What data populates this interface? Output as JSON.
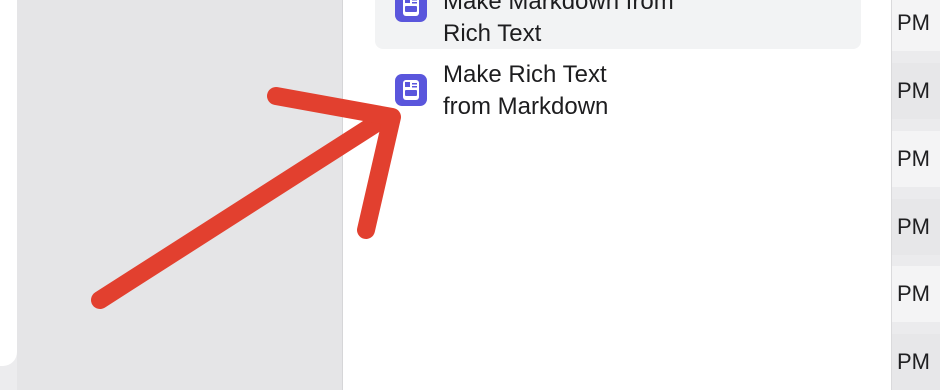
{
  "actions": [
    {
      "icon": "rich-text-icon",
      "line1": "Make Markdown from",
      "line2": "Rich Text"
    },
    {
      "icon": "rich-text-icon",
      "line1": "Make Rich Text",
      "line2": "from Markdown"
    }
  ],
  "time_column": [
    "PM",
    "PM",
    "PM",
    "PM",
    "PM",
    "PM"
  ],
  "annotation": {
    "icon": "red-arrow-icon",
    "color": "#e2402f"
  }
}
